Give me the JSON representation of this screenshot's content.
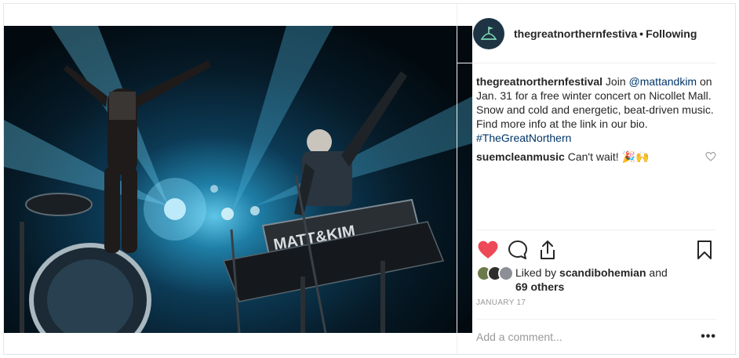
{
  "post": {
    "username": "thegreatnorthernfestiva",
    "follow_separator": "•",
    "follow_status": "Following"
  },
  "caption": {
    "username": "thegreatnorthernfestival",
    "text_before_mention": " Join ",
    "mention": "@mattandkim",
    "text_after_mention": " on Jan. 31 for a free winter concert on Nicollet Mall. Snow and cold and energetic, beat-driven music. Find more info at the link in our bio. ",
    "hashtag": "#TheGreatNorthern"
  },
  "reply": {
    "username": "suemcleanmusic",
    "text": " Can't wait! 🎉🙌"
  },
  "photo": {
    "keyboard_text": "MATT&KIM"
  },
  "likes": {
    "prefix": "Liked by ",
    "user": "scandibohemian",
    "middle": " and ",
    "others": "69 others"
  },
  "date": "JANUARY 17",
  "comment_box": {
    "placeholder": "Add a comment...",
    "more": "•••"
  },
  "colors": {
    "like_active": "#ed4956",
    "link": "#003569"
  }
}
